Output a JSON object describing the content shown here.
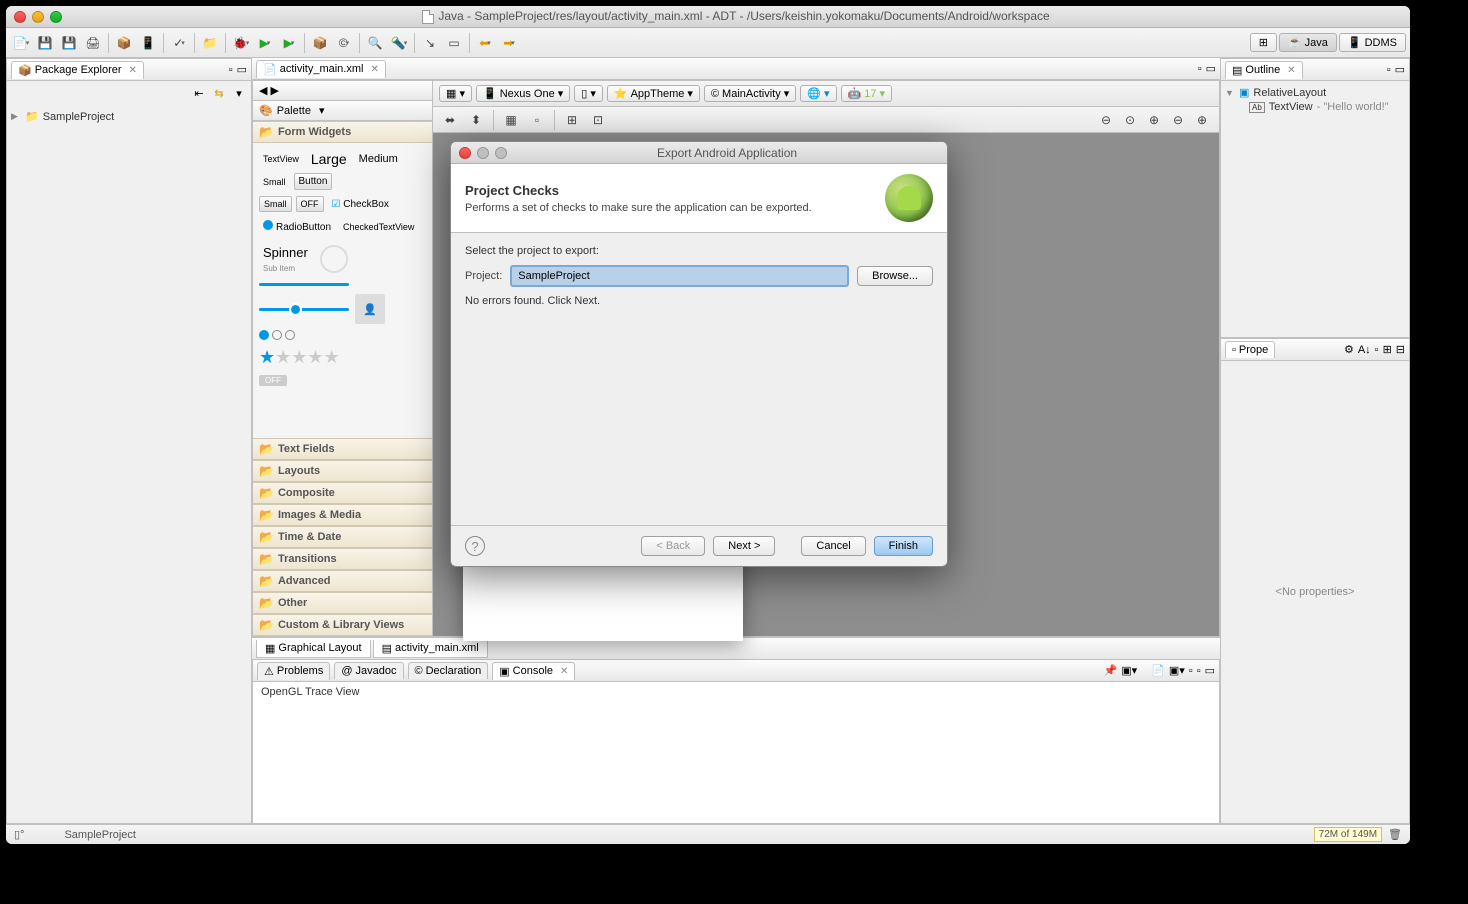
{
  "window": {
    "title": "Java - SampleProject/res/layout/activity_main.xml - ADT - /Users/keishin.yokomaku/Documents/Android/workspace"
  },
  "perspectives": {
    "java": "Java",
    "ddms": "DDMS"
  },
  "package_explorer": {
    "title": "Package Explorer",
    "project": "SampleProject"
  },
  "editor": {
    "tab": "activity_main.xml",
    "palette": "Palette",
    "cat_form_widgets": "Form Widgets",
    "widgets": {
      "textview": "TextView",
      "large": "Large",
      "medium": "Medium",
      "small": "Small",
      "button": "Button",
      "small_btn": "Small",
      "off": "OFF",
      "checkbox": "CheckBox",
      "radiobutton": "RadioButton",
      "checkedtextview": "CheckedTextView",
      "spinner": "Spinner",
      "subitem": "Sub Item"
    },
    "cats": [
      "Text Fields",
      "Layouts",
      "Composite",
      "Images & Media",
      "Time & Date",
      "Transitions",
      "Advanced",
      "Other",
      "Custom & Library Views"
    ],
    "bottom_tabs": {
      "graphical": "Graphical Layout",
      "xml": "activity_main.xml"
    },
    "config": {
      "device": "Nexus One",
      "theme": "AppTheme",
      "activity": "MainActivity",
      "api": "17"
    }
  },
  "outline": {
    "title": "Outline",
    "root": "RelativeLayout",
    "child": "TextView",
    "child_text": "- \"Hello world!\""
  },
  "properties": {
    "title": "Prope",
    "empty": "<No properties>"
  },
  "console": {
    "tabs": [
      "Problems",
      "Javadoc",
      "Declaration",
      "Console"
    ],
    "text": "OpenGL Trace View"
  },
  "status": {
    "project": "SampleProject",
    "mem": "72M of 149M"
  },
  "dialog": {
    "title": "Export Android Application",
    "heading": "Project Checks",
    "subheading": "Performs a set of checks to make sure the application can be exported.",
    "select_label": "Select the project to export:",
    "project_label": "Project:",
    "project_value": "SampleProject",
    "browse": "Browse...",
    "status": "No errors found. Click Next.",
    "back": "< Back",
    "next": "Next >",
    "cancel": "Cancel",
    "finish": "Finish"
  }
}
